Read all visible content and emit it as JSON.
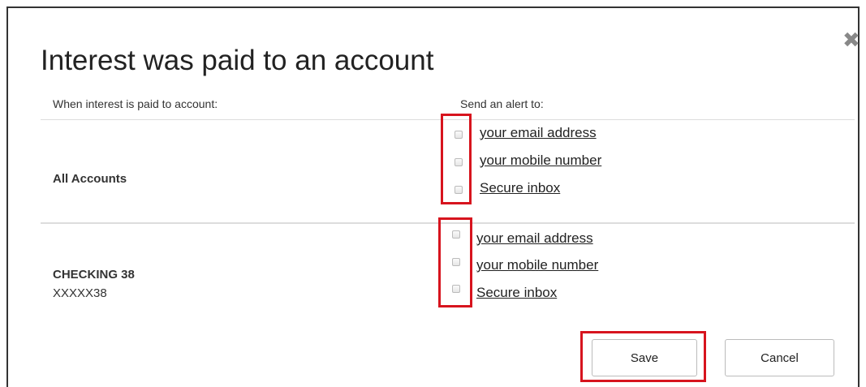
{
  "dialog": {
    "title": "Interest was paid to an account",
    "close_icon": "close-icon"
  },
  "columns": {
    "left_header": "When interest is paid to account:",
    "right_header": "Send an alert to:"
  },
  "rows": [
    {
      "account_name": "All Accounts",
      "account_number": "",
      "options": [
        {
          "label": "your email address",
          "checked": false
        },
        {
          "label": "your mobile number",
          "checked": false
        },
        {
          "label": "Secure inbox",
          "checked": false
        }
      ]
    },
    {
      "account_name": "CHECKING 38",
      "account_number": "XXXXX38",
      "options": [
        {
          "label": "your email address",
          "checked": false
        },
        {
          "label": "your mobile number",
          "checked": false
        },
        {
          "label": "Secure inbox",
          "checked": false
        }
      ]
    }
  ],
  "buttons": {
    "save": "Save",
    "cancel": "Cancel"
  },
  "colors": {
    "highlight": "#d7141e",
    "border": "#333333"
  }
}
